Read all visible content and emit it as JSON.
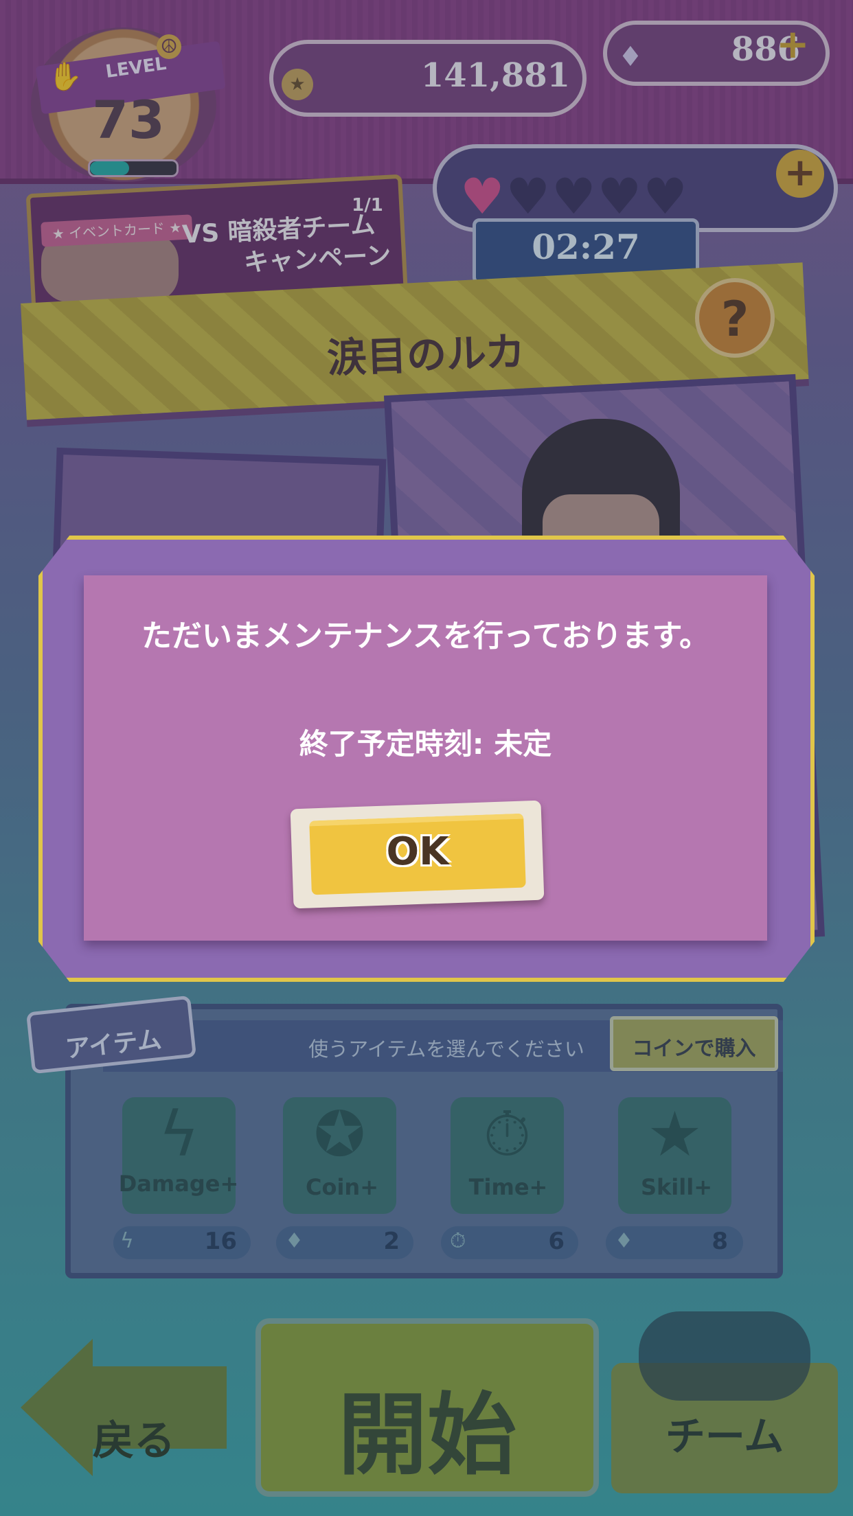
{
  "header": {
    "level_label": "LEVEL",
    "level": "73",
    "level_progress": 0.45,
    "coins": "141,881",
    "gems": "886"
  },
  "event": {
    "tag": "★ イベントカード ★",
    "title_line1": "VS 暗殺者チーム",
    "title_line2": "キャンペーン",
    "count": "1/1"
  },
  "stamina": {
    "hearts_full": 1,
    "hearts_total": 5,
    "timer": "02:27"
  },
  "stage": {
    "title": "涙目のルカ",
    "help_symbol": "?"
  },
  "items": {
    "section_label": "アイテム",
    "instruction": "使うアイテムを選んでください",
    "buy_label": "コインで購入",
    "list": [
      {
        "label": "Damage+",
        "count": "16",
        "icon": "lightning-icon"
      },
      {
        "label": "Coin+",
        "count": "2",
        "icon": "gem-icon"
      },
      {
        "label": "Time+",
        "count": "6",
        "icon": "stopwatch-icon"
      },
      {
        "label": "Skill+",
        "count": "8",
        "icon": "gem-icon"
      }
    ]
  },
  "nav": {
    "back_label": "戻る",
    "start_label": "開始",
    "team_label": "チーム"
  },
  "dialog": {
    "message": "ただいまメンテナンスを行っております。",
    "end_time": "終了予定時刻: 未定",
    "ok_label": "OK"
  },
  "colors": {
    "dialog_frame": "#8b6ab1",
    "dialog_border": "#e0c64a",
    "dialog_panel": "#b577b0",
    "ok_button": "#f0c440"
  }
}
